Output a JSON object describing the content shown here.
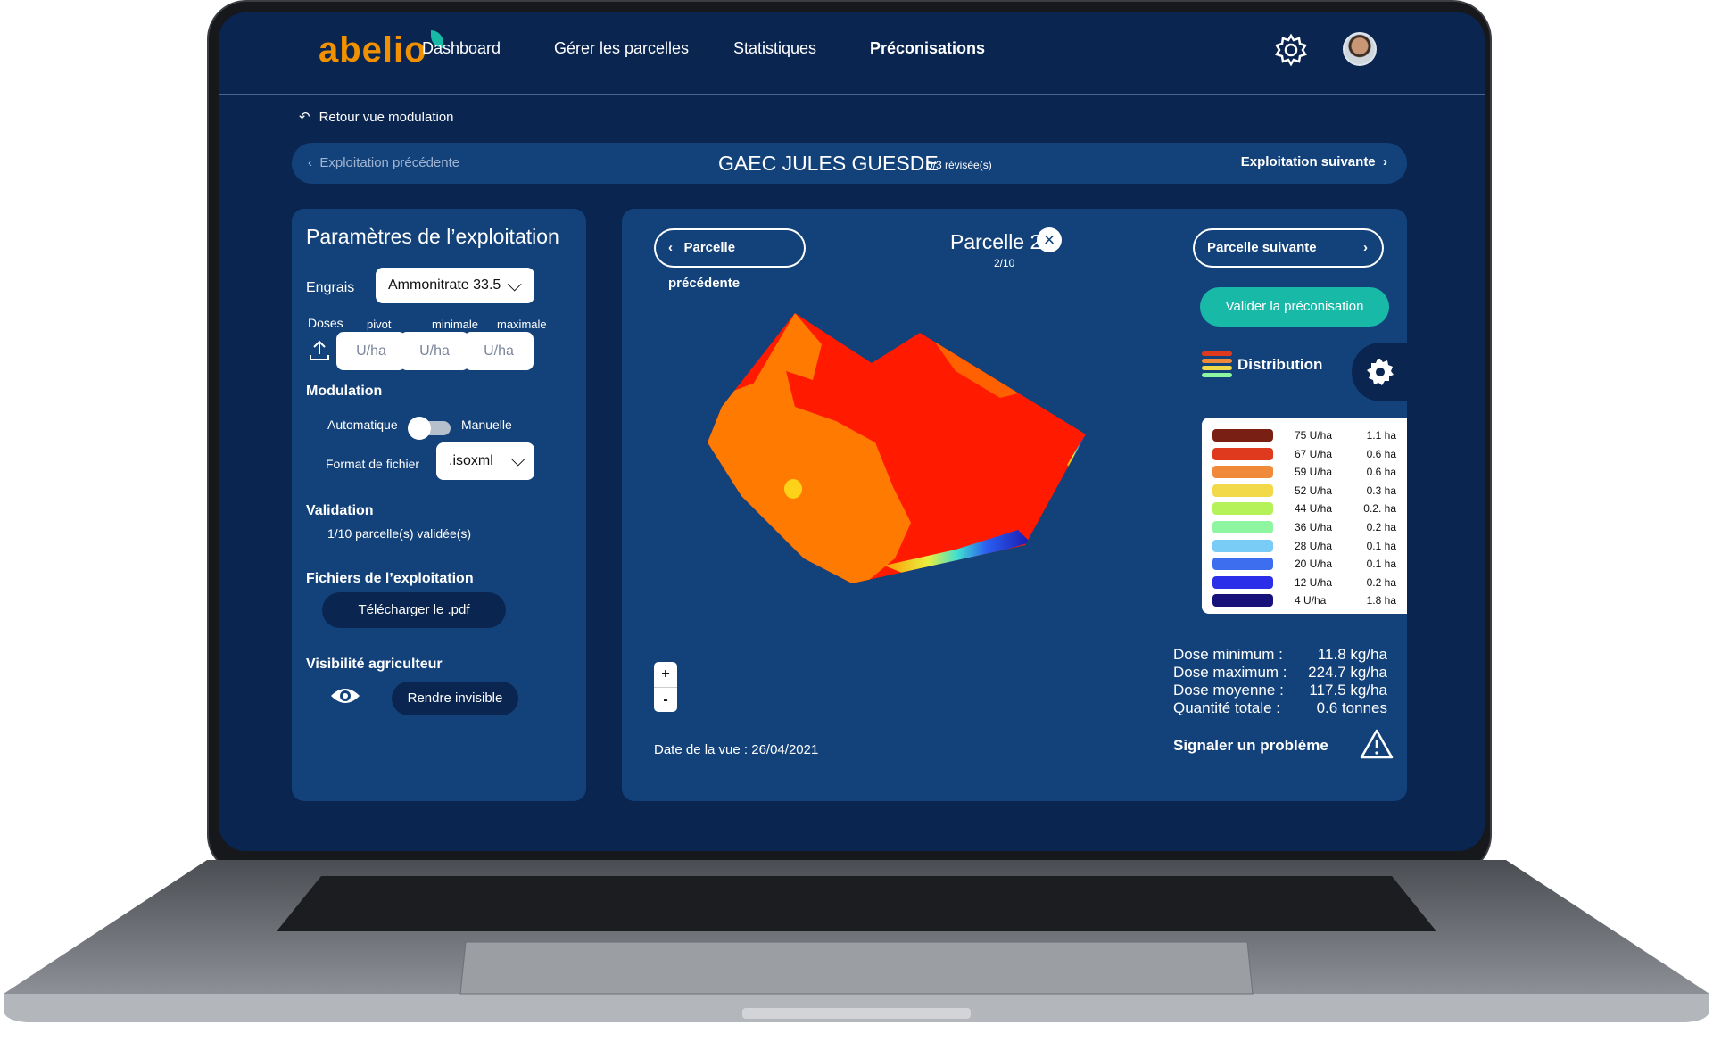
{
  "nav": {
    "logo": "abelio",
    "items": [
      "Dashboard",
      "Gérer les parcelles",
      "Statistiques",
      "Préconisations"
    ],
    "active": "Préconisations"
  },
  "back_link": "Retour vue modulation",
  "farm_bar": {
    "prev": "Exploitation précédente",
    "name": "GAEC JULES GUESDE",
    "reviewed": "0/3 révisée(s)",
    "next": "Exploitation suivante"
  },
  "left_panel": {
    "title": "Paramètres de l’exploitation",
    "engrais_label": "Engrais",
    "engrais_value": "Ammonitrate 33.5",
    "doses_label": "Doses",
    "dose_columns": [
      "pivot",
      "minimale",
      "maximale"
    ],
    "dose_placeholder": "U/ha",
    "modulation_label": "Modulation",
    "mode_auto": "Automatique",
    "mode_manual": "Manuelle",
    "format_label": "Format de fichier",
    "format_value": ".isoxml",
    "validation_label": "Validation",
    "validation_text": "1/10 parcelle(s) validée(s)",
    "files_label": "Fichiers de l’exploitation",
    "download_btn": "Télécharger le .pdf",
    "visibility_label": "Visibilité agriculteur",
    "visibility_btn": "Rendre invisible"
  },
  "main_panel": {
    "prev_btn": "Parcelle précédente",
    "next_btn": "Parcelle suivante",
    "parcel_title": "Parcelle 2",
    "parcel_index": "2/10",
    "validate_btn": "Valider la préconisation",
    "distribution_label": "Distribution",
    "legend": [
      {
        "dose": "75 U/ha",
        "area": "1.1 ha",
        "color": "#7a1f14"
      },
      {
        "dose": "67 U/ha",
        "area": "0.6 ha",
        "color": "#e03a1e"
      },
      {
        "dose": "59 U/ha",
        "area": "0.6 ha",
        "color": "#f08a3a"
      },
      {
        "dose": "52 U/ha",
        "area": "0.3 ha",
        "color": "#f2d94a"
      },
      {
        "dose": "44 U/ha",
        "area": "0.2. ha",
        "color": "#b5f25a"
      },
      {
        "dose": "36 U/ha",
        "area": "0.2 ha",
        "color": "#8ef5a0"
      },
      {
        "dose": "28 U/ha",
        "area": "0.1 ha",
        "color": "#78ccf5"
      },
      {
        "dose": "20 U/ha",
        "area": "0.1 ha",
        "color": "#3d6ef0"
      },
      {
        "dose": "12 U/ha",
        "area": "0.2 ha",
        "color": "#2a2ee8"
      },
      {
        "dose": "4 U/ha",
        "area": "1.8 ha",
        "color": "#17127a"
      }
    ],
    "stats": [
      {
        "k": "Dose minimum :",
        "v": "11.8 kg/ha"
      },
      {
        "k": "Dose maximum :",
        "v": "224.7 kg/ha"
      },
      {
        "k": "Dose moyenne :",
        "v": "117.5 kg/ha"
      },
      {
        "k": "Quantité totale :",
        "v": "0.6 tonnes"
      }
    ],
    "zoom_in": "+",
    "zoom_out": "-",
    "date": "Date de la vue : 26/04/2021",
    "report": "Signaler un problème"
  },
  "colors": {
    "bg": "#0a2550",
    "panel": "#13427a",
    "accent": "#19b9a8",
    "logo": "#f29100"
  }
}
